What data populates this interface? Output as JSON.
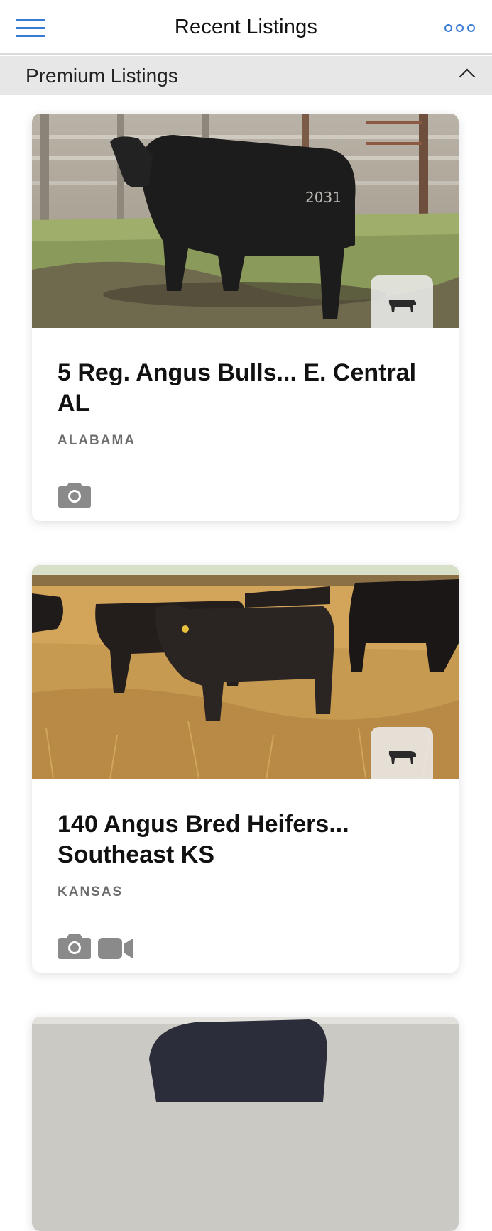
{
  "header": {
    "title": "Recent Listings"
  },
  "section": {
    "title": "Premium Listings"
  },
  "listings": [
    {
      "title": "5 Reg. Angus Bulls... E. Central AL",
      "state": "ALABAMA",
      "media": [
        "camera-icon"
      ],
      "photo": "black-angus-bull"
    },
    {
      "title": "140 Angus Bred Heifers... Southeast KS",
      "state": "KANSAS",
      "media": [
        "camera-icon",
        "video-icon"
      ],
      "photo": "angus-heifers-in-field"
    },
    {
      "title": "",
      "state": "",
      "media": [],
      "photo": "black-cow"
    }
  ],
  "colors": {
    "accent": "#3a7bd5",
    "section_bar": "#e7e7e8",
    "muted_text": "#6d6d6d",
    "icon_gray": "#8a8a8a"
  }
}
